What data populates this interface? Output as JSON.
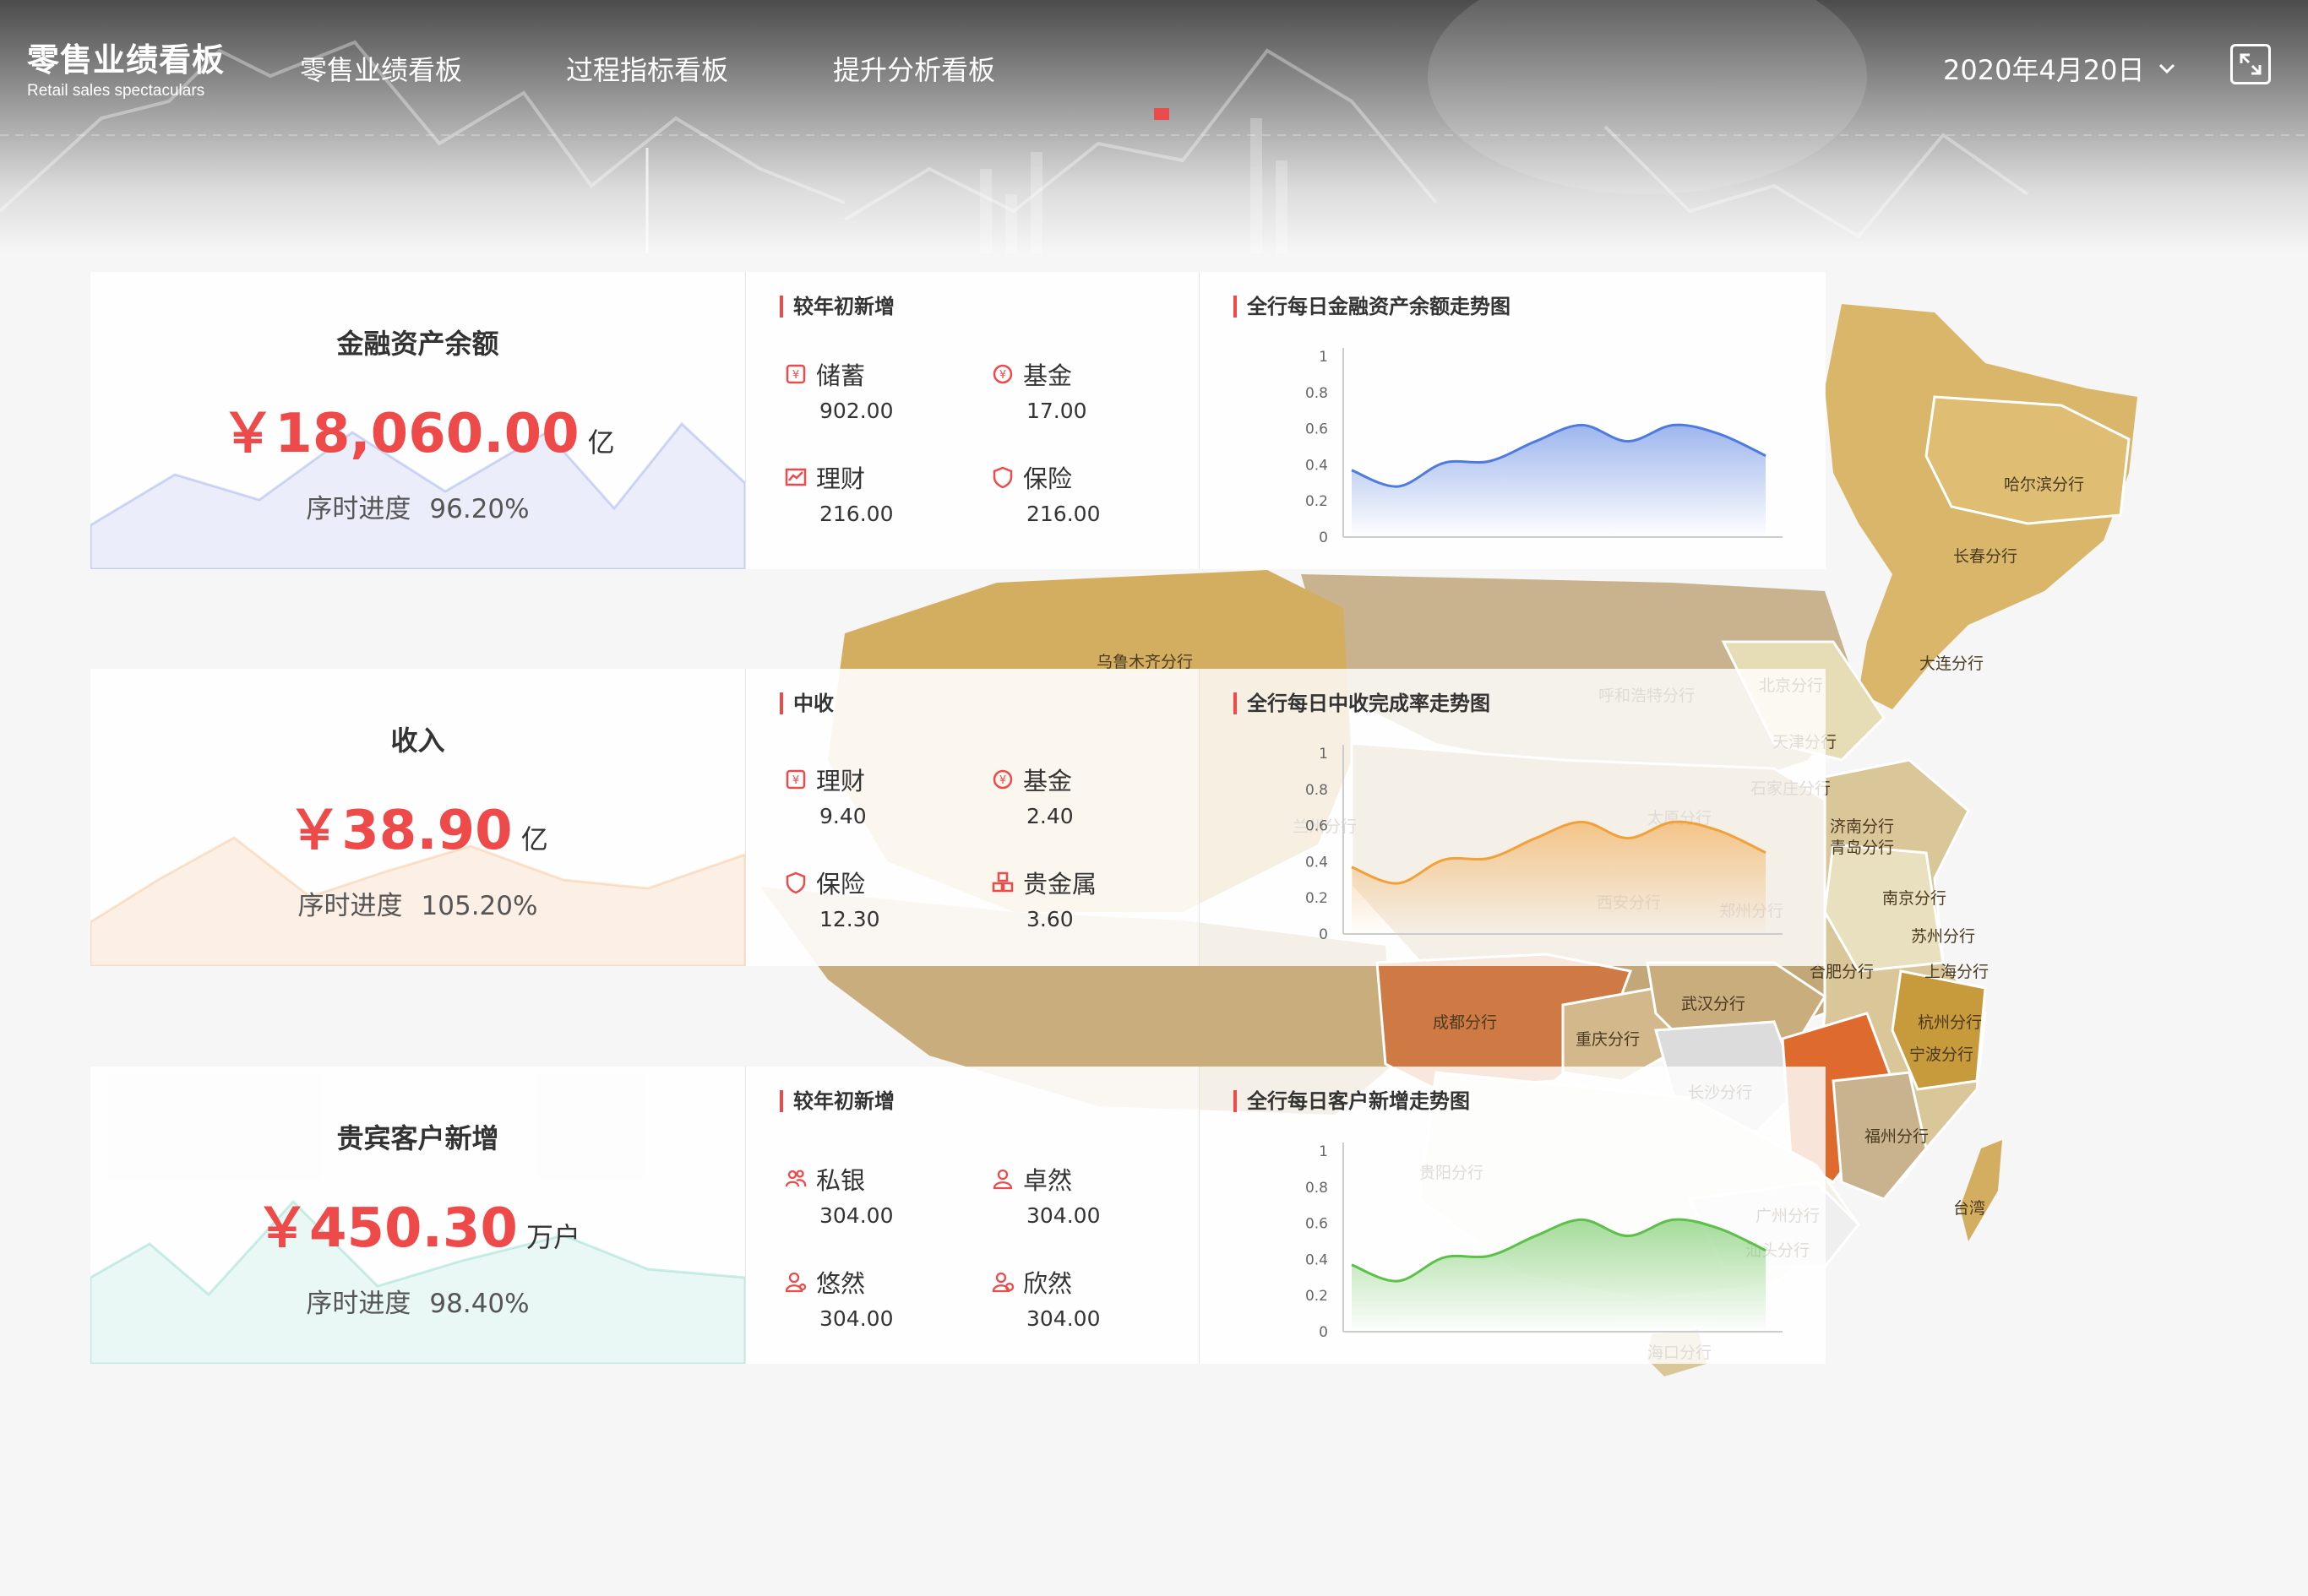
{
  "header": {
    "logo_cn": "零售业绩看板",
    "logo_en": "Retail sales spectaculars",
    "nav": [
      "零售业绩看板",
      "过程指标看板",
      "提升分析看板"
    ],
    "date": "2020年4月20日",
    "icons": [
      "chevron-down-icon",
      "expand-icon"
    ]
  },
  "map": {
    "labels": [
      "哈尔滨分行",
      "长春分行",
      "大连分行",
      "北京分行",
      "天津分行",
      "石家庄分行",
      "呼和浩特分行",
      "乌鲁木齐分行",
      "济南分行",
      "青岛分行",
      "南京分行",
      "苏州分行",
      "合肥分行",
      "上海分行",
      "杭州分行",
      "宁波分行",
      "武汉分行",
      "成都分行",
      "重庆分行",
      "长沙分行",
      "福州分行",
      "广州分行",
      "汕头分行",
      "台湾",
      "海口分行",
      "郑州分行",
      "西安分行",
      "兰州分行",
      "太原分行",
      "贵阳分行"
    ]
  },
  "rows": [
    {
      "kpi": {
        "title": "金融资产余额",
        "value": "￥18,060.00",
        "unit": "亿",
        "progress_label": "序时进度",
        "progress_value": "96.20%"
      },
      "breakdown_title": "较年初新增",
      "items": [
        {
          "label": "储蓄",
          "value": "902.00",
          "icon": "savings-icon"
        },
        {
          "label": "基金",
          "value": "17.00",
          "icon": "fund-icon"
        },
        {
          "label": "理财",
          "value": "216.00",
          "icon": "wealth-chart-icon"
        },
        {
          "label": "保险",
          "value": "216.00",
          "icon": "insurance-shield-icon"
        }
      ],
      "trend_title": "全行每日金融资产余额走势图",
      "color": "#4f7be0"
    },
    {
      "kpi": {
        "title": "收入",
        "value": "￥38.90",
        "unit": "亿",
        "progress_label": "序时进度",
        "progress_value": "105.20%"
      },
      "breakdown_title": "中收",
      "items": [
        {
          "label": "理财",
          "value": "9.40",
          "icon": "wealth-icon"
        },
        {
          "label": "基金",
          "value": "2.40",
          "icon": "fund-icon"
        },
        {
          "label": "保险",
          "value": "12.30",
          "icon": "insurance-shield-icon"
        },
        {
          "label": "贵金属",
          "value": "3.60",
          "icon": "gold-bars-icon"
        }
      ],
      "trend_title": "全行每日中收完成率走势图",
      "color": "#f2a13a"
    },
    {
      "kpi": {
        "title": "贵宾客户新增",
        "value": "￥450.30",
        "unit": "万户",
        "progress_label": "序时进度",
        "progress_value": "98.40%"
      },
      "breakdown_title": "较年初新增",
      "items": [
        {
          "label": "私银",
          "value": "304.00",
          "icon": "private-bank-users-icon"
        },
        {
          "label": "卓然",
          "value": "304.00",
          "icon": "user-icon"
        },
        {
          "label": "悠然",
          "value": "304.00",
          "icon": "user-badge-icon"
        },
        {
          "label": "欣然",
          "value": "304.00",
          "icon": "user-check-icon"
        }
      ],
      "trend_title": "全行每日客户新增走势图",
      "color": "#5cc04a"
    }
  ],
  "chart_data": [
    {
      "type": "area",
      "title": "全行每日金融资产余额走势图",
      "y_ticks": [
        "0",
        "0.2",
        "0.4",
        "0.6",
        "0.8",
        "1"
      ],
      "ylim": [
        0,
        1
      ],
      "values": [
        0.37,
        0.28,
        0.41,
        0.42,
        0.53,
        0.62,
        0.53,
        0.62,
        0.57,
        0.45
      ]
    },
    {
      "type": "area",
      "title": "全行每日中收完成率走势图",
      "y_ticks": [
        "0",
        "0.2",
        "0.4",
        "0.6",
        "0.8",
        "1"
      ],
      "ylim": [
        0,
        1
      ],
      "values": [
        0.37,
        0.28,
        0.41,
        0.42,
        0.53,
        0.62,
        0.53,
        0.62,
        0.57,
        0.45
      ]
    },
    {
      "type": "area",
      "title": "全行每日客户新增走势图",
      "y_ticks": [
        "0",
        "0.2",
        "0.4",
        "0.6",
        "0.8",
        "1"
      ],
      "ylim": [
        0,
        1
      ],
      "values": [
        0.37,
        0.28,
        0.41,
        0.42,
        0.53,
        0.62,
        0.53,
        0.62,
        0.57,
        0.45
      ]
    }
  ]
}
